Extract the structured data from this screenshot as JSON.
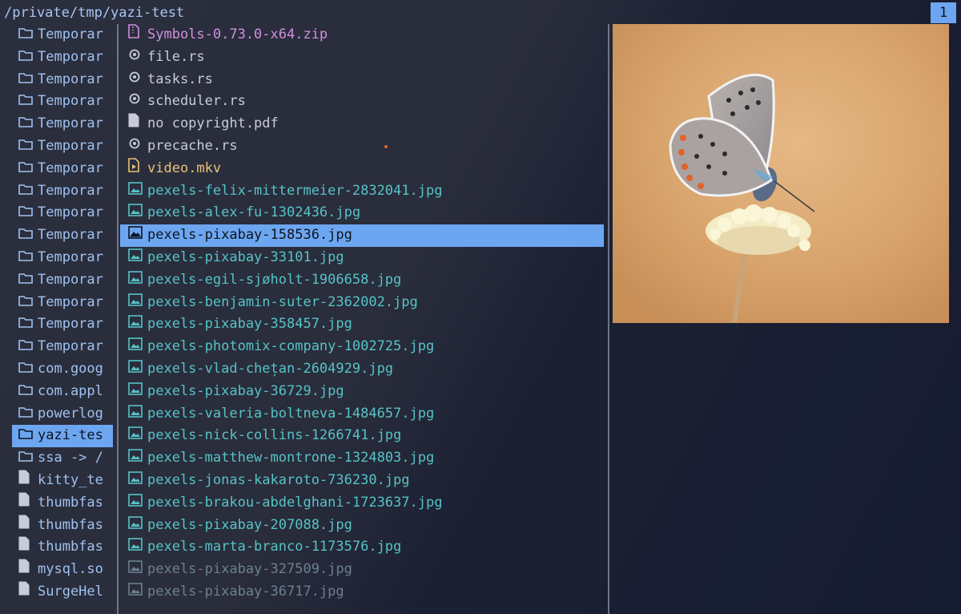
{
  "header": {
    "path": "/private/tmp/yazi-test",
    "tab_number": "1"
  },
  "parent_list": [
    {
      "name": "Temporar",
      "kind": "dir"
    },
    {
      "name": "Temporar",
      "kind": "dir"
    },
    {
      "name": "Temporar",
      "kind": "dir"
    },
    {
      "name": "Temporar",
      "kind": "dir"
    },
    {
      "name": "Temporar",
      "kind": "dir"
    },
    {
      "name": "Temporar",
      "kind": "dir"
    },
    {
      "name": "Temporar",
      "kind": "dir"
    },
    {
      "name": "Temporar",
      "kind": "dir"
    },
    {
      "name": "Temporar",
      "kind": "dir"
    },
    {
      "name": "Temporar",
      "kind": "dir"
    },
    {
      "name": "Temporar",
      "kind": "dir"
    },
    {
      "name": "Temporar",
      "kind": "dir"
    },
    {
      "name": "Temporar",
      "kind": "dir"
    },
    {
      "name": "Temporar",
      "kind": "dir"
    },
    {
      "name": "Temporar",
      "kind": "dir"
    },
    {
      "name": "com.goog",
      "kind": "dir"
    },
    {
      "name": "com.appl",
      "kind": "dir"
    },
    {
      "name": "powerlog",
      "kind": "dir"
    },
    {
      "name": "yazi-tes",
      "kind": "dir",
      "selected": true
    },
    {
      "name": "ssa -> /",
      "kind": "dir"
    },
    {
      "name": "kitty_te",
      "kind": "file"
    },
    {
      "name": "thumbfas",
      "kind": "file"
    },
    {
      "name": "thumbfas",
      "kind": "file"
    },
    {
      "name": "thumbfas",
      "kind": "file"
    },
    {
      "name": "mysql.so",
      "kind": "file"
    },
    {
      "name": "SurgeHel",
      "kind": "file",
      "dim": true
    }
  ],
  "current_list": [
    {
      "name": "Symbols-0.73.0-x64.zip",
      "kind": "zip"
    },
    {
      "name": "file.rs",
      "kind": "rust"
    },
    {
      "name": "tasks.rs",
      "kind": "rust"
    },
    {
      "name": "scheduler.rs",
      "kind": "rust"
    },
    {
      "name": "no copyright.pdf",
      "kind": "file"
    },
    {
      "name": "precache.rs",
      "kind": "rust"
    },
    {
      "name": "video.mkv",
      "kind": "video"
    },
    {
      "name": "pexels-felix-mittermeier-2832041.jpg",
      "kind": "img"
    },
    {
      "name": "pexels-alex-fu-1302436.jpg",
      "kind": "img"
    },
    {
      "name": "pexels-pixabay-158536.jpg",
      "kind": "img",
      "selected": true
    },
    {
      "name": "pexels-pixabay-33101.jpg",
      "kind": "img"
    },
    {
      "name": "pexels-egil-sjøholt-1906658.jpg",
      "kind": "img"
    },
    {
      "name": "pexels-benjamin-suter-2362002.jpg",
      "kind": "img"
    },
    {
      "name": "pexels-pixabay-358457.jpg",
      "kind": "img"
    },
    {
      "name": "pexels-photomix-company-1002725.jpg",
      "kind": "img"
    },
    {
      "name": "pexels-vlad-chețan-2604929.jpg",
      "kind": "img"
    },
    {
      "name": "pexels-pixabay-36729.jpg",
      "kind": "img"
    },
    {
      "name": "pexels-valeria-boltneva-1484657.jpg",
      "kind": "img"
    },
    {
      "name": "pexels-nick-collins-1266741.jpg",
      "kind": "img"
    },
    {
      "name": "pexels-matthew-montrone-1324803.jpg",
      "kind": "img"
    },
    {
      "name": "pexels-jonas-kakaroto-736230.jpg",
      "kind": "img"
    },
    {
      "name": "pexels-brakou-abdelghani-1723637.jpg",
      "kind": "img"
    },
    {
      "name": "pexels-pixabay-207088.jpg",
      "kind": "img"
    },
    {
      "name": "pexels-marta-branco-1173576.jpg",
      "kind": "img"
    },
    {
      "name": "pexels-pixabay-327509.jpg",
      "kind": "img",
      "dim": true
    },
    {
      "name": "pexels-pixabay-36717.jpg",
      "kind": "img",
      "dim": true
    }
  ],
  "preview": {
    "icon": "butterfly-image-preview"
  },
  "colors": {
    "accent": "#6da6f0",
    "dir": "#9fc2f0",
    "image": "#56c3c7",
    "zip": "#d08fe0",
    "video": "#e8c27a"
  }
}
